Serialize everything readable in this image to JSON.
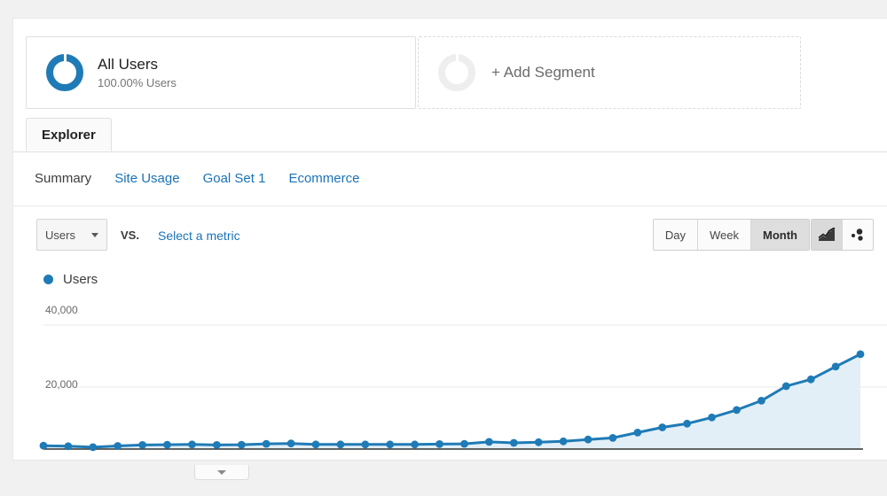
{
  "page": {
    "background_color": "#f1f1f1",
    "accent_color": "#1f7bb6",
    "link_color": "#1a73b7"
  },
  "segments": {
    "all_users": {
      "title": "All Users",
      "subtitle": "100.00% Users",
      "icon": "donut-ring-icon",
      "icon_color": "#1f7bb6"
    },
    "add_segment": {
      "label": "+ Add Segment",
      "icon": "donut-ring-placeholder-icon",
      "icon_color": "#eeeeee"
    }
  },
  "tabs": {
    "primary": [
      {
        "label": "Explorer",
        "active": true
      }
    ],
    "secondary": [
      {
        "label": "Summary",
        "active": true
      },
      {
        "label": "Site Usage",
        "active": false
      },
      {
        "label": "Goal Set 1",
        "active": false
      },
      {
        "label": "Ecommerce",
        "active": false
      }
    ]
  },
  "controls": {
    "metric_select": {
      "value": "Users",
      "caret_icon": "chevron-down-icon"
    },
    "vs_label": "VS.",
    "compare_metric": "Select a metric",
    "granularity": [
      {
        "label": "Day",
        "active": false
      },
      {
        "label": "Week",
        "active": false
      },
      {
        "label": "Month",
        "active": true
      }
    ],
    "view_icons": [
      {
        "name": "line-chart-icon",
        "active": true
      },
      {
        "name": "motion-chart-icon",
        "active": false
      }
    ]
  },
  "legend": {
    "series_label": "Users",
    "dot_color": "#1f7bb6"
  },
  "bottom": {
    "collapse_handle_icon": "chevron-down-icon"
  },
  "chart_data": {
    "type": "area",
    "title": "Users",
    "xlabel": "",
    "ylabel": "",
    "ylim": [
      0,
      48000
    ],
    "yticks": [
      20000,
      40000
    ],
    "ytick_labels": [
      "20,000",
      "40,000"
    ],
    "grid": true,
    "legend_position": "top-left",
    "line_color": "#1f7bb6",
    "fill_color": "#e3eff6",
    "marker": "circle",
    "series": [
      {
        "name": "Users",
        "values": [
          1100,
          900,
          600,
          1000,
          1300,
          1400,
          1500,
          1300,
          1400,
          1700,
          1800,
          1500,
          1500,
          1500,
          1500,
          1500,
          1600,
          1700,
          2300,
          2000,
          2200,
          2500,
          3100,
          3600,
          5300,
          7000,
          8200,
          10200,
          12600,
          15600,
          20300,
          22500,
          26600,
          30600
        ]
      }
    ]
  }
}
